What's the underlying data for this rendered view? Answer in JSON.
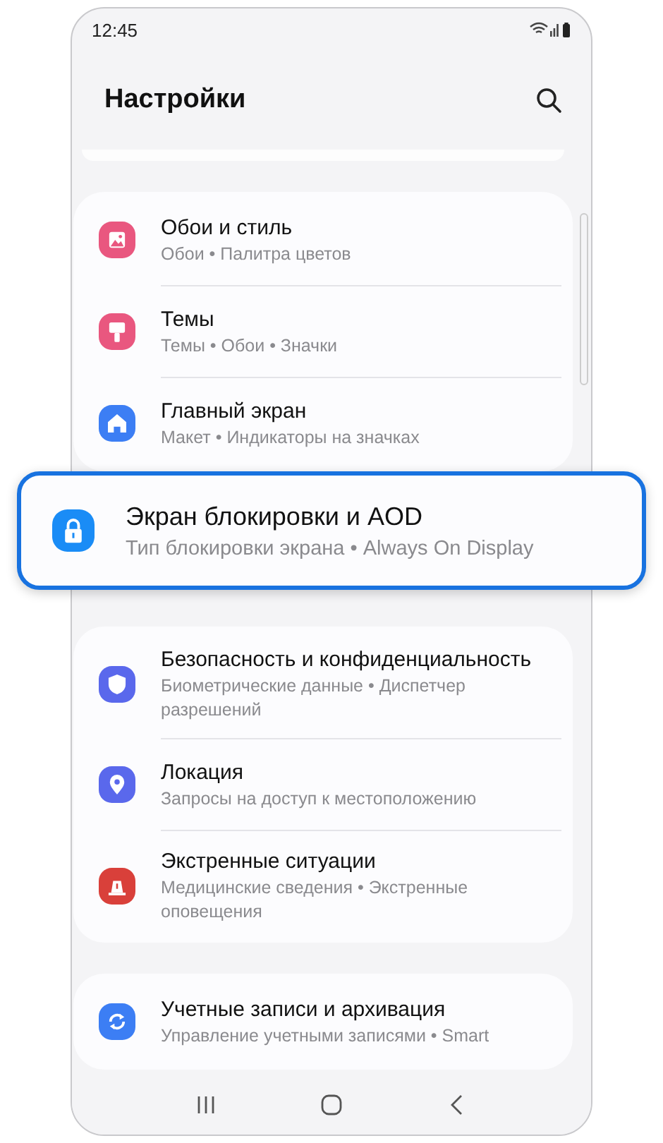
{
  "status_bar": {
    "time": "12:45"
  },
  "title": "Настройки",
  "sections": [
    {
      "kind": "card",
      "items": [
        {
          "title": "Обои и стиль",
          "subtitle": "Обои • Палитра цветов",
          "color": "#e9577f"
        },
        {
          "title": "Темы",
          "subtitle": "Темы • Обои • Значки",
          "color": "#e9577f"
        },
        {
          "title": "Главный экран",
          "subtitle": "Макет • Индикаторы на значках",
          "color": "#3c7ef4"
        }
      ]
    },
    {
      "kind": "highlight",
      "items": [
        {
          "title": "Экран блокировки и AOD",
          "subtitle": "Тип блокировки экрана • Always On Display",
          "color": "#1a8cf6"
        }
      ]
    },
    {
      "kind": "card",
      "items": [
        {
          "title": "Безопасность и конфиденциальность",
          "subtitle": "Биометрические данные • Диспетчер разрешений",
          "color": "#5a68ec"
        },
        {
          "title": "Локация",
          "subtitle": "Запросы на доступ к местоположению",
          "color": "#5a68ec"
        },
        {
          "title": "Экстренные ситуации",
          "subtitle": "Медицинские сведения • Экстренные оповещения",
          "color": "#d9403a"
        }
      ]
    },
    {
      "kind": "card",
      "items": [
        {
          "title": "Учетные записи и архивация",
          "subtitle": "Управление учетными записями • Smart",
          "color": "#3c7ef4"
        }
      ]
    }
  ]
}
